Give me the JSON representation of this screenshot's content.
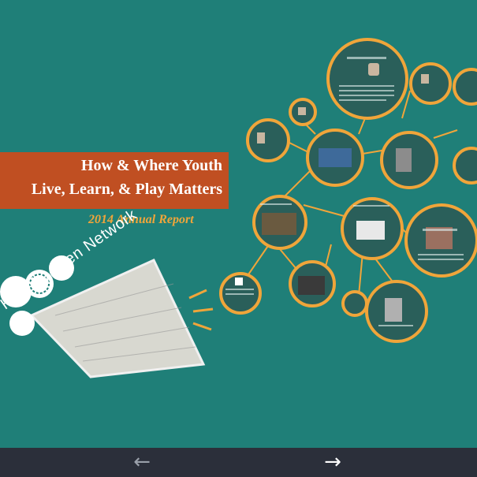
{
  "title": {
    "line1": "How & Where Youth",
    "line2": "Live, Learn, & Play Matters",
    "subtitle": "2014 Annual Report"
  },
  "brand": {
    "name": "Healthy Teen Network"
  },
  "nav": {
    "prev_icon": "arrow-left-icon",
    "next_icon": "arrow-right-icon"
  },
  "colors": {
    "background": "#1f7f78",
    "orange_band": "#c04f22",
    "accent": "#f0a53a",
    "nav_bar": "#2b2f3a"
  }
}
